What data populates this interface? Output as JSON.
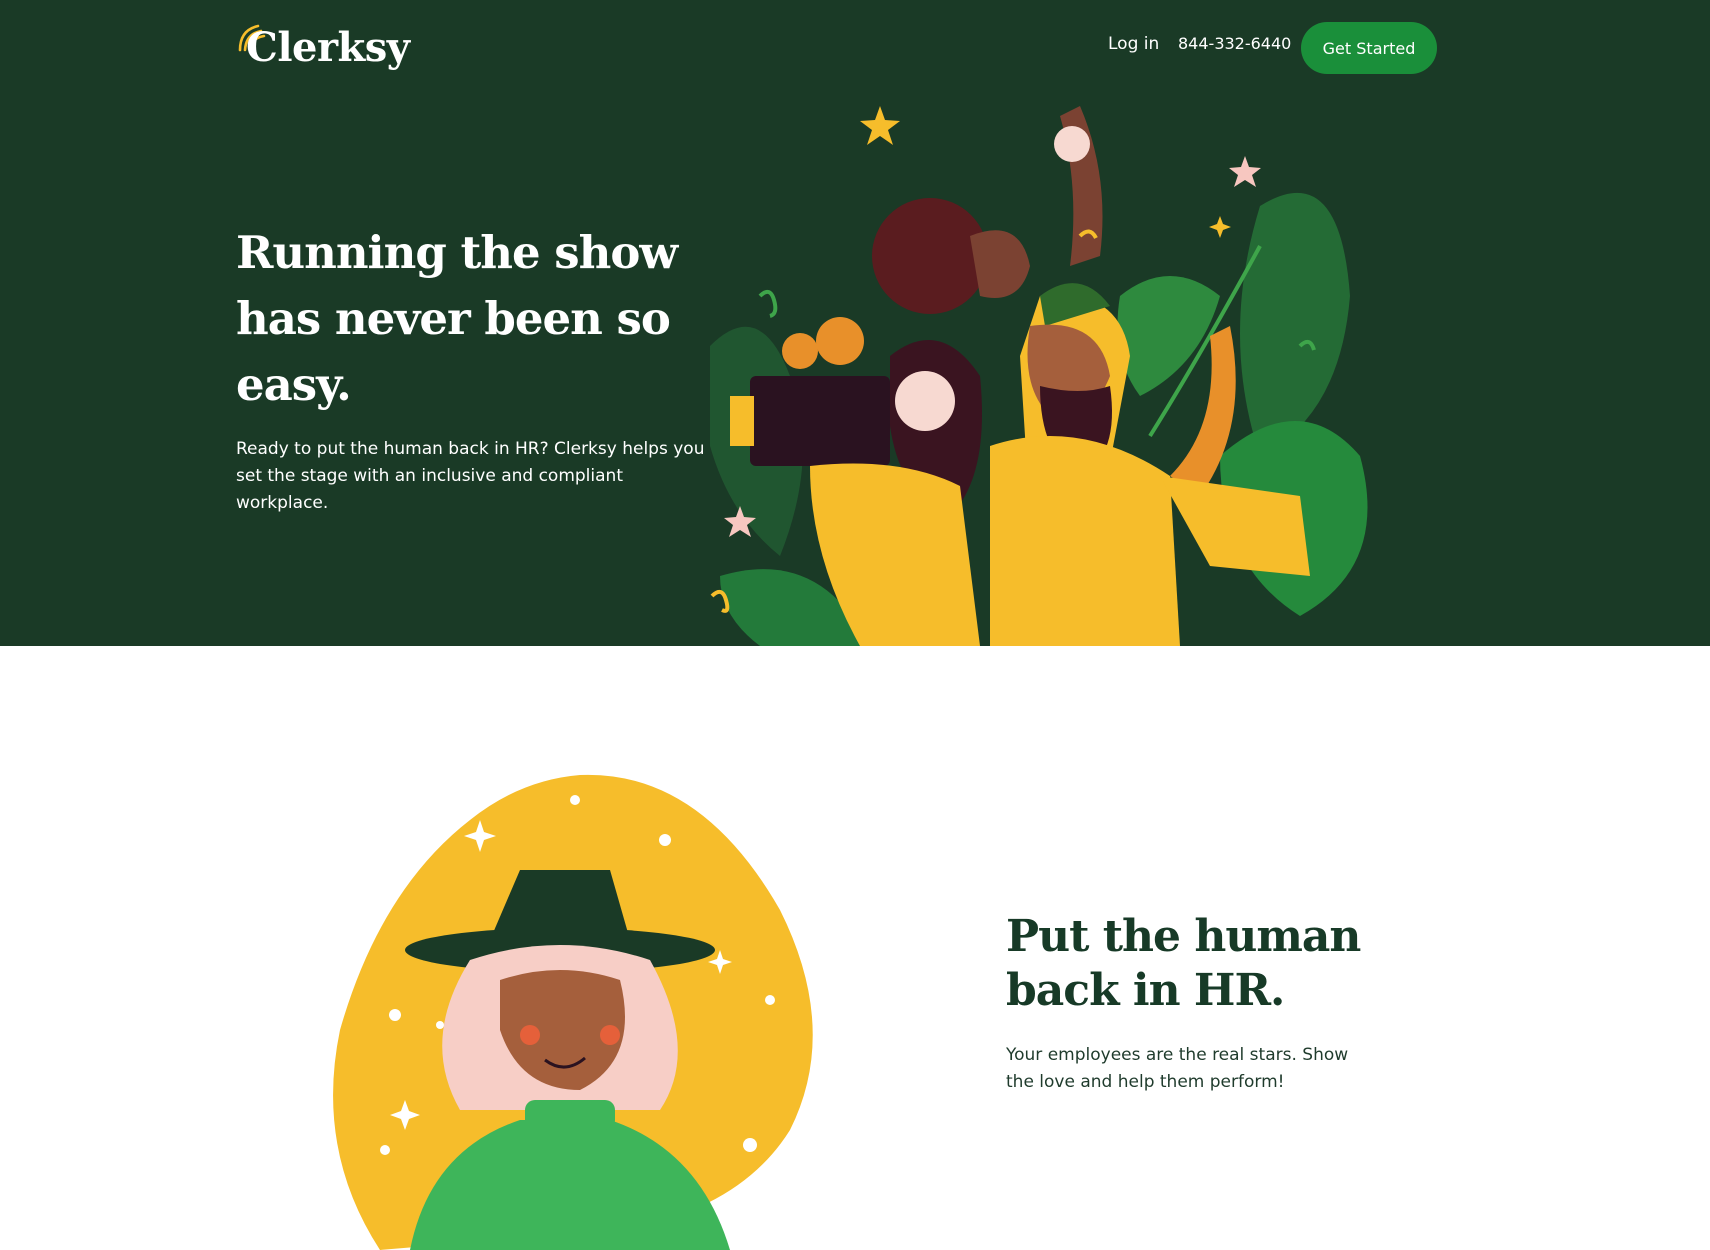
{
  "brand": {
    "name": "Clerksy"
  },
  "nav": {
    "login_label": "Log in",
    "phone": "844-332-6440",
    "cta_label": "Get Started"
  },
  "hero": {
    "title": "Running the show has never been so easy.",
    "subtitle": "Ready to put the human back in HR? Clerksy helps you set the stage with an inclusive and compliant workplace."
  },
  "feature": {
    "title": "Put the human back in HR.",
    "subtitle": "Your employees are the real stars. Show the love and help them perform!"
  },
  "colors": {
    "hero_bg": "#1a3a26",
    "cta_bg": "#1a8f3a",
    "accent_yellow": "#f6bd2b",
    "heading_dark": "#173a27"
  },
  "icons": [
    "logo-swoosh-icon",
    "star-icon",
    "sparkle-icon"
  ]
}
